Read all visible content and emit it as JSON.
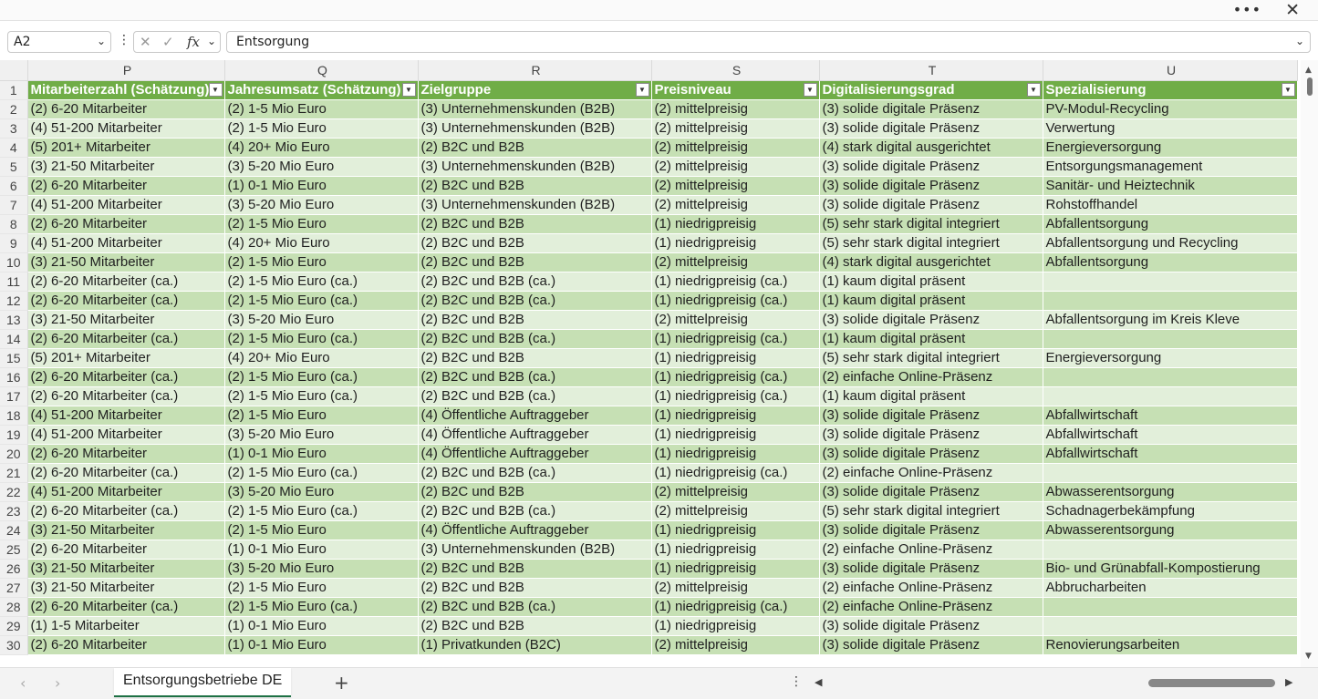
{
  "window": {
    "more_icon": "more-horizontal-icon",
    "close_icon": "close-icon"
  },
  "formula_bar": {
    "name_box": "A2",
    "content": "Entsorgung"
  },
  "columns": [
    "P",
    "Q",
    "R",
    "S",
    "T",
    "U"
  ],
  "header_row": [
    "Mitarbeiterzahl (Schätzung)",
    "Jahresumsatz (Schätzung)",
    "Zielgruppe",
    "Preisniveau",
    "Digitalisierungsgrad",
    "Spezialisierung"
  ],
  "rows": [
    [
      "2",
      "(2) 6-20 Mitarbeiter",
      "(2) 1-5 Mio Euro",
      "(3) Unternehmenskunden (B2B)",
      "(2) mittelpreisig",
      "(3) solide digitale Präsenz",
      "PV-Modul-Recycling"
    ],
    [
      "3",
      "(4) 51-200 Mitarbeiter",
      "(2) 1-5 Mio Euro",
      "(3) Unternehmenskunden (B2B)",
      "(2) mittelpreisig",
      "(3) solide digitale Präsenz",
      "Verwertung"
    ],
    [
      "4",
      "(5) 201+ Mitarbeiter",
      "(4) 20+ Mio Euro",
      "(2) B2C und B2B",
      "(2) mittelpreisig",
      "(4) stark digital ausgerichtet",
      "Energieversorgung"
    ],
    [
      "5",
      "(3) 21-50 Mitarbeiter",
      "(3) 5-20 Mio Euro",
      "(3) Unternehmenskunden (B2B)",
      "(2) mittelpreisig",
      "(3) solide digitale Präsenz",
      "Entsorgungsmanagement"
    ],
    [
      "6",
      "(2) 6-20 Mitarbeiter",
      "(1) 0-1 Mio Euro",
      "(2) B2C und B2B",
      "(2) mittelpreisig",
      "(3) solide digitale Präsenz",
      "Sanitär- und Heiztechnik"
    ],
    [
      "7",
      "(4) 51-200 Mitarbeiter",
      "(3) 5-20 Mio Euro",
      "(3) Unternehmenskunden (B2B)",
      "(2) mittelpreisig",
      "(3) solide digitale Präsenz",
      "Rohstoffhandel"
    ],
    [
      "8",
      "(2) 6-20 Mitarbeiter",
      "(2) 1-5 Mio Euro",
      "(2) B2C und B2B",
      "(1) niedrigpreisig",
      "(5) sehr stark digital integriert",
      "Abfallentsorgung"
    ],
    [
      "9",
      "(4) 51-200 Mitarbeiter",
      "(4) 20+ Mio Euro",
      "(2) B2C und B2B",
      "(1) niedrigpreisig",
      "(5) sehr stark digital integriert",
      "Abfallentsorgung und Recycling"
    ],
    [
      "10",
      "(3) 21-50 Mitarbeiter",
      "(2) 1-5 Mio Euro",
      "(2) B2C und B2B",
      "(2) mittelpreisig",
      "(4) stark digital ausgerichtet",
      "Abfallentsorgung"
    ],
    [
      "11",
      "(2) 6-20 Mitarbeiter (ca.)",
      "(2) 1-5 Mio Euro (ca.)",
      "(2) B2C und B2B (ca.)",
      "(1) niedrigpreisig (ca.)",
      "(1) kaum digital präsent",
      ""
    ],
    [
      "12",
      "(2) 6-20 Mitarbeiter (ca.)",
      "(2) 1-5 Mio Euro (ca.)",
      "(2) B2C und B2B (ca.)",
      "(1) niedrigpreisig (ca.)",
      "(1) kaum digital präsent",
      ""
    ],
    [
      "13",
      "(3) 21-50 Mitarbeiter",
      "(3) 5-20 Mio Euro",
      "(2) B2C und B2B",
      "(2) mittelpreisig",
      "(3) solide digitale Präsenz",
      "Abfallentsorgung im Kreis Kleve"
    ],
    [
      "14",
      "(2) 6-20 Mitarbeiter (ca.)",
      "(2) 1-5 Mio Euro (ca.)",
      "(2) B2C und B2B (ca.)",
      "(1) niedrigpreisig (ca.)",
      "(1) kaum digital präsent",
      ""
    ],
    [
      "15",
      "(5) 201+ Mitarbeiter",
      "(4) 20+ Mio Euro",
      "(2) B2C und B2B",
      "(1) niedrigpreisig",
      "(5) sehr stark digital integriert",
      "Energieversorgung"
    ],
    [
      "16",
      "(2) 6-20 Mitarbeiter (ca.)",
      "(2) 1-5 Mio Euro (ca.)",
      "(2) B2C und B2B (ca.)",
      "(1) niedrigpreisig (ca.)",
      "(2) einfache Online-Präsenz",
      ""
    ],
    [
      "17",
      "(2) 6-20 Mitarbeiter (ca.)",
      "(2) 1-5 Mio Euro (ca.)",
      "(2) B2C und B2B (ca.)",
      "(1) niedrigpreisig (ca.)",
      "(1) kaum digital präsent",
      ""
    ],
    [
      "18",
      "(4) 51-200 Mitarbeiter",
      "(2) 1-5 Mio Euro",
      "(4) Öffentliche Auftraggeber",
      "(1) niedrigpreisig",
      "(3) solide digitale Präsenz",
      "Abfallwirtschaft"
    ],
    [
      "19",
      "(4) 51-200 Mitarbeiter",
      "(3) 5-20 Mio Euro",
      "(4) Öffentliche Auftraggeber",
      "(1) niedrigpreisig",
      "(3) solide digitale Präsenz",
      "Abfallwirtschaft"
    ],
    [
      "20",
      "(2) 6-20 Mitarbeiter",
      "(1) 0-1 Mio Euro",
      "(4) Öffentliche Auftraggeber",
      "(1) niedrigpreisig",
      "(3) solide digitale Präsenz",
      "Abfallwirtschaft"
    ],
    [
      "21",
      "(2) 6-20 Mitarbeiter (ca.)",
      "(2) 1-5 Mio Euro (ca.)",
      "(2) B2C und B2B (ca.)",
      "(1) niedrigpreisig (ca.)",
      "(2) einfache Online-Präsenz",
      ""
    ],
    [
      "22",
      "(4) 51-200 Mitarbeiter",
      "(3) 5-20 Mio Euro",
      "(2) B2C und B2B",
      "(2) mittelpreisig",
      "(3) solide digitale Präsenz",
      "Abwasserentsorgung"
    ],
    [
      "23",
      "(2) 6-20 Mitarbeiter (ca.)",
      "(2) 1-5 Mio Euro (ca.)",
      "(2) B2C und B2B (ca.)",
      "(2) mittelpreisig",
      "(5) sehr stark digital integriert",
      "Schadnagerbekämpfung"
    ],
    [
      "24",
      "(3) 21-50 Mitarbeiter",
      "(2) 1-5 Mio Euro",
      "(4) Öffentliche Auftraggeber",
      "(1) niedrigpreisig",
      "(3) solide digitale Präsenz",
      "Abwasserentsorgung"
    ],
    [
      "25",
      "(2) 6-20 Mitarbeiter",
      "(1) 0-1 Mio Euro",
      "(3) Unternehmenskunden (B2B)",
      "(1) niedrigpreisig",
      "(2) einfache Online-Präsenz",
      ""
    ],
    [
      "26",
      "(3) 21-50 Mitarbeiter",
      "(3) 5-20 Mio Euro",
      "(2) B2C und B2B",
      "(1) niedrigpreisig",
      "(3) solide digitale Präsenz",
      "Bio- und Grünabfall-Kompostierung"
    ],
    [
      "27",
      "(3) 21-50 Mitarbeiter",
      "(2) 1-5 Mio Euro",
      "(2) B2C und B2B",
      "(2) mittelpreisig",
      "(2) einfache Online-Präsenz",
      "Abbrucharbeiten"
    ],
    [
      "28",
      "(2) 6-20 Mitarbeiter (ca.)",
      "(2) 1-5 Mio Euro (ca.)",
      "(2) B2C und B2B (ca.)",
      "(1) niedrigpreisig (ca.)",
      "(2) einfache Online-Präsenz",
      ""
    ],
    [
      "29",
      "(1) 1-5 Mitarbeiter",
      "(1) 0-1 Mio Euro",
      "(2) B2C und B2B",
      "(1) niedrigpreisig",
      "(3) solide digitale Präsenz",
      ""
    ],
    [
      "30",
      "(2) 6-20 Mitarbeiter",
      "(1) 0-1 Mio Euro",
      "(1) Privatkunden (B2C)",
      "(2) mittelpreisig",
      "(3) solide digitale Präsenz",
      "Renovierungsarbeiten"
    ]
  ],
  "sheet_tabs": [
    "Entsorgungsbetriebe DE"
  ],
  "colors": {
    "header_green": "#70ad47",
    "band_dark": "#c6e0b4",
    "band_light": "#e2efda"
  }
}
